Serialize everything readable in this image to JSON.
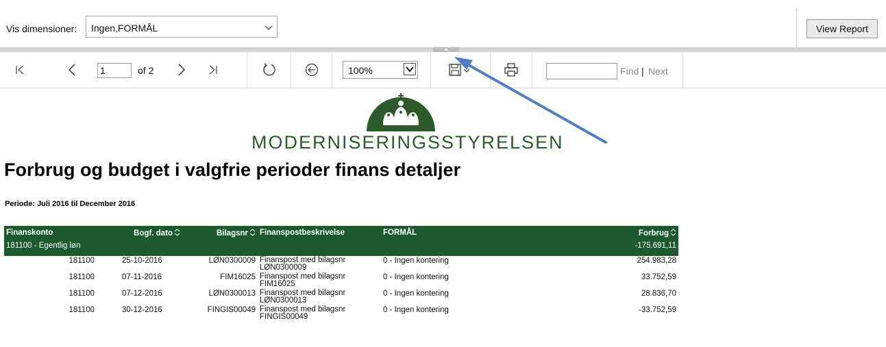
{
  "params": {
    "label": "Vis dimensioner:",
    "dimension_value": "Ingen,FORMÅL",
    "view_report_label": "View Report"
  },
  "toolbar": {
    "current_page": "1",
    "page_of": "of 2",
    "zoom": "100%",
    "find_label": "Find",
    "find_separator": "|",
    "next_label": "Next",
    "find_placeholder": ""
  },
  "report": {
    "logo_text": "MODERNISERINGSSTYRELSEN",
    "title": "Forbrug og budget i valgfrie perioder finans detaljer",
    "period": "Periode: Juli 2016 til December 2016",
    "columns": {
      "finanskonto": "Finanskonto",
      "bogf_dato": "Bogf. dato",
      "bilagsnr": "Bilagsnr",
      "beskrivelse": "Finanspostbeskrivelse",
      "formaal": "FORMÅL",
      "forbrug": "Forbrug"
    },
    "group": {
      "label": "181100 - Egentlig løn",
      "total": "-175.691,11"
    },
    "rows": [
      {
        "konto": "181100",
        "dato": "25-10-2016",
        "bilag": "LØN0300009",
        "desc1": "Finanspost med bilagsnr",
        "desc2": "LØN0300009",
        "formaal": "0 - Ingen kontering",
        "forbrug": "254.983,28"
      },
      {
        "konto": "181100",
        "dato": "07-11-2016",
        "bilag": "FIM16025",
        "desc1": "Finanspost med bilagsnr",
        "desc2": "FIM16025",
        "formaal": "0 - Ingen kontering",
        "forbrug": "33.752,59"
      },
      {
        "konto": "181100",
        "dato": "07-12-2016",
        "bilag": "LØN0300013",
        "desc1": "Finanspost med bilagsnr",
        "desc2": "LØN0300013",
        "formaal": "0 - Ingen kontering",
        "forbrug": "28.836,70"
      },
      {
        "konto": "181100",
        "dato": "30-12-2016",
        "bilag": "FINGIS00049",
        "desc1": "Finanspost med bilagsnr",
        "desc2": "FINGIS00049",
        "formaal": "0 - Ingen kontering",
        "forbrug": "-33.752,59"
      }
    ]
  },
  "colors": {
    "header_green": "#1e5a30",
    "logo_green": "#2d5a2d",
    "arrow_blue": "#4f7fc0"
  },
  "icons": [
    "first-page-icon",
    "previous-page-icon",
    "next-page-icon",
    "last-page-icon",
    "refresh-icon",
    "back-icon",
    "save-icon",
    "chevron-down-icon",
    "print-icon",
    "sort-icon",
    "crown-logo-icon",
    "arrow-annotation-icon"
  ]
}
